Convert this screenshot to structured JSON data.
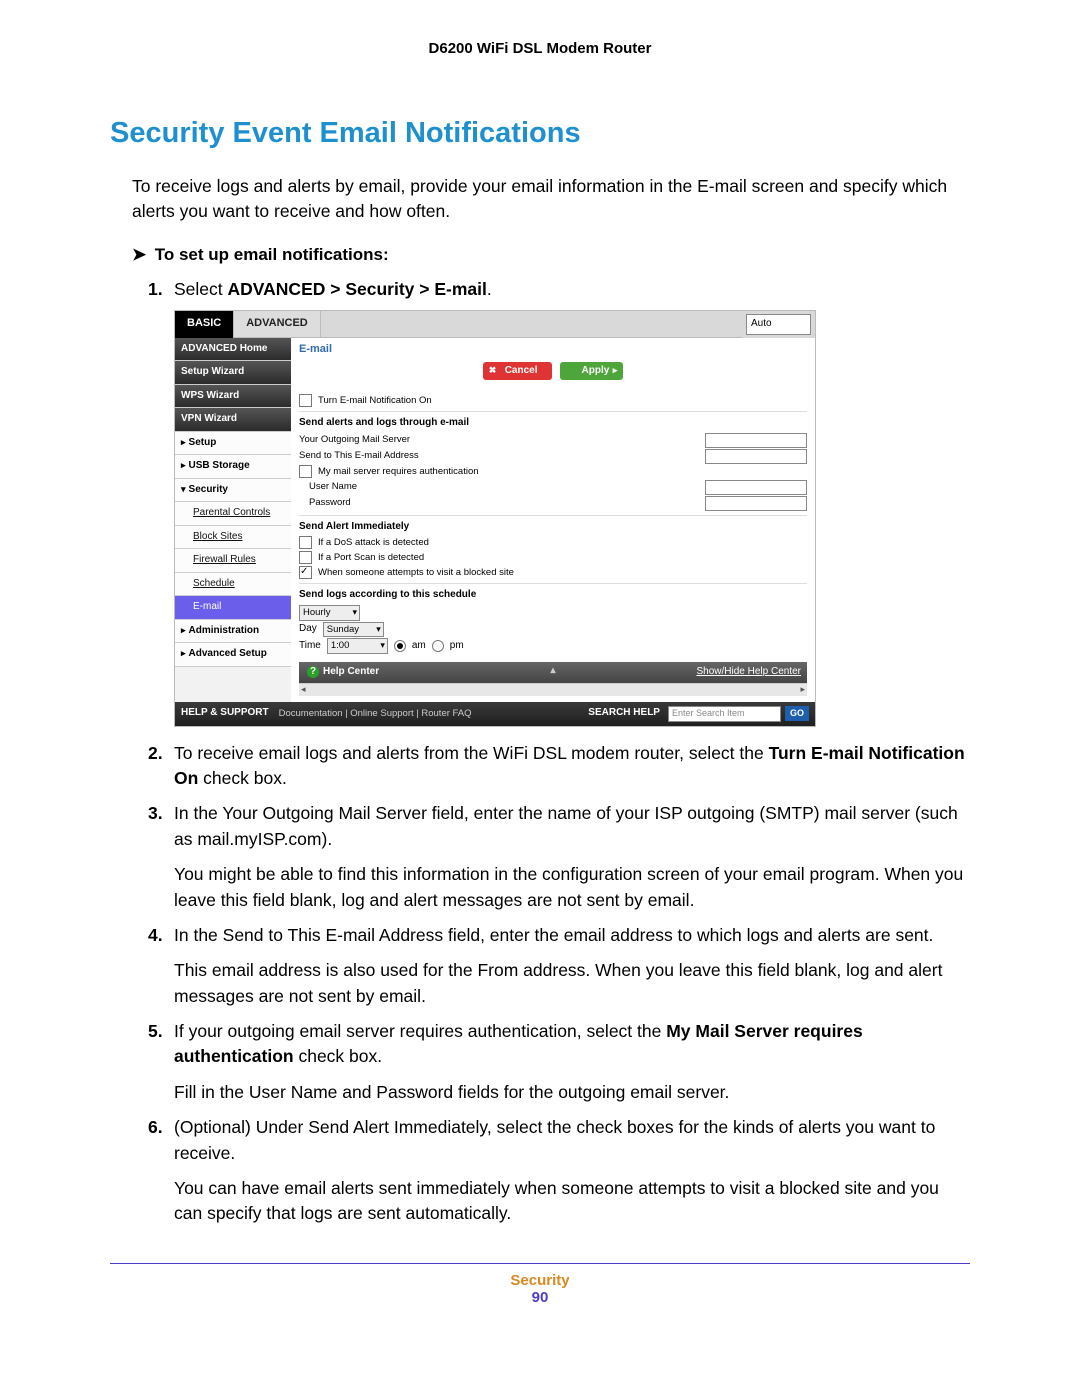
{
  "doc_header": "D6200 WiFi DSL Modem Router",
  "section_title": "Security Event Email Notifications",
  "intro": "To receive logs and alerts by email, provide your email information in the E-mail screen and specify which alerts you want to receive and how often.",
  "proc_header": "To set up email notifications:",
  "steps": {
    "s1_a": "Select ",
    "s1_b": "ADVANCED > Security > E-mail",
    "s1_c": ".",
    "s2_a": "To receive email logs and alerts from the WiFi DSL modem router, select the ",
    "s2_b": "Turn E-mail Notification On",
    "s2_c": " check box.",
    "s3": "In the Your Outgoing Mail Server field, enter the name of your ISP outgoing (SMTP) mail server (such as mail.myISP.com).",
    "s3_extra": "You might be able to find this information in the configuration screen of your email program. When you leave this field blank, log and alert messages are not sent by email.",
    "s4": "In the Send to This E-mail Address field, enter the email address to which logs and alerts are sent.",
    "s4_extra": "This email address is also used for the From address. When you leave this field blank, log and alert messages are not sent by email.",
    "s5_a": "If your outgoing email server requires authentication, select the ",
    "s5_b": "My Mail Server requires authentication",
    "s5_c": " check box.",
    "s5_extra": "Fill in the User Name and Password fields for the outgoing email server.",
    "s6": "(Optional) Under Send Alert Immediately, select the check boxes for the kinds of alerts you want to receive.",
    "s6_extra": "You can have email alerts sent immediately when someone attempts to visit a blocked site and you can specify that logs are sent automatically."
  },
  "router": {
    "tab_basic": "BASIC",
    "tab_advanced": "ADVANCED",
    "auto": "Auto",
    "side": {
      "home": "ADVANCED Home",
      "setup_wizard": "Setup Wizard",
      "wps_wizard": "WPS Wizard",
      "vpn_wizard": "VPN Wizard",
      "setup": "Setup",
      "usb": "USB Storage",
      "security": "Security",
      "parental": "Parental Controls",
      "block_sites": "Block Sites",
      "firewall": "Firewall Rules",
      "schedule": "Schedule",
      "email": "E-mail",
      "admin": "Administration",
      "adv_setup": "Advanced Setup"
    },
    "main": {
      "title": "E-mail",
      "cancel": "Cancel",
      "apply": "Apply",
      "turn_on": "Turn E-mail Notification On",
      "grp_send": "Send alerts and logs through e-mail",
      "outgoing": "Your Outgoing Mail Server",
      "send_to": "Send to This E-mail Address",
      "auth": "My mail server requires authentication",
      "user": "User Name",
      "pass": "Password",
      "grp_imm": "Send Alert Immediately",
      "dos": "If a DoS attack is detected",
      "port": "If a Port Scan is detected",
      "blocked": "When someone attempts to visit a blocked site",
      "grp_sched": "Send logs according to this schedule",
      "hourly": "Hourly",
      "day_lbl": "Day",
      "day_val": "Sunday",
      "time_lbl": "Time",
      "time_val": "1:00",
      "am": "am",
      "pm": "pm",
      "help": "Help Center",
      "help_toggle": "Show/Hide Help Center"
    },
    "footer": {
      "help_support": "HELP & SUPPORT",
      "links": "Documentation | Online Support | Router FAQ",
      "search_lbl": "SEARCH HELP",
      "search_ph": "Enter Search Item",
      "go": "GO"
    }
  },
  "page_footer": {
    "category": "Security",
    "page": "90"
  }
}
